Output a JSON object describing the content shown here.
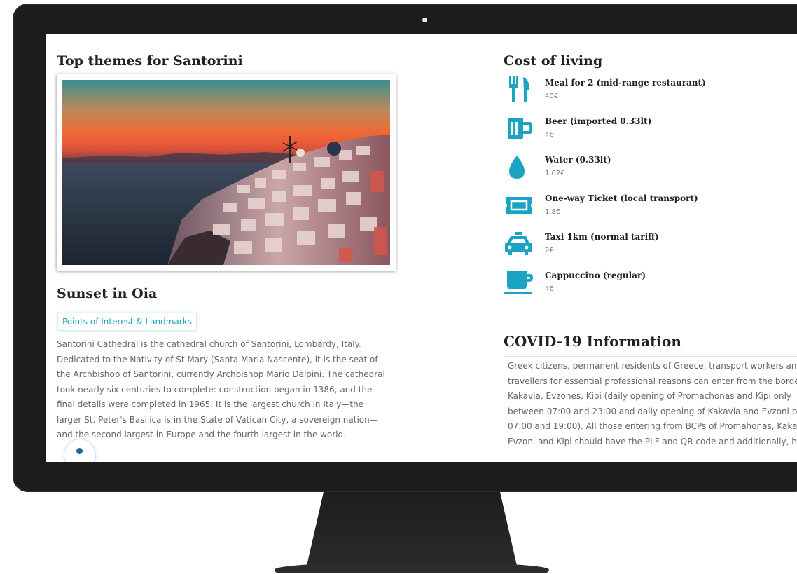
{
  "left": {
    "top_title": "Top themes for Santorini",
    "place_title": "Sunset in Oia",
    "tag": "Points of Interest & Landmarks",
    "description": "Santorini Cathedral is the cathedral church of Santorini, Lombardy, Italy. Dedicated to the Nativity of St Mary (Santa Maria Nascente), it is the seat of the Archbishop of Santorini, currently Archbishop Mario Delpini. The cathedral took nearly six centuries to complete: construction began in 1386, and the final details were completed in 1965. It is the largest church in Italy—the larger St. Peter's Basilica is in the State of Vatican City, a sovereign nation—and the second largest in Europe and the fourth largest in the world."
  },
  "cost": {
    "title": "Cost of living",
    "icon_color": "#1aa3c2",
    "items": [
      {
        "label": "Meal for 2 (mid-range restaurant)",
        "price": "40€",
        "icon": "fork-knife-icon"
      },
      {
        "label": "Beer (imported 0.33lt)",
        "price": "4€",
        "icon": "beer-mug-icon"
      },
      {
        "label": "Water (0.33lt)",
        "price": "1.62€",
        "icon": "water-drop-icon"
      },
      {
        "label": "One-way Ticket (local transport)",
        "price": "1.8€",
        "icon": "ticket-icon"
      },
      {
        "label": "Taxi 1km (normal tariff)",
        "price": "2€",
        "icon": "taxi-icon"
      },
      {
        "label": "Cappuccino (regular)",
        "price": "4€",
        "icon": "coffee-cup-icon"
      }
    ]
  },
  "covid": {
    "title": "COVID-19 Information",
    "text": "Greek citizens, permanent residents of Greece, transport workers and\ntravellers for essential professional reasons can enter from the borders of\nKakavia, Evzones, Kipi (daily opening of Promachonas and Kipi only\nbetween 07:00 and 23:00 and daily opening of Kakavia and Evzoni between\n07:00 and 19:00). All those entering from BCPs of Promahonas, Kakavia,\nEvzoni and Kipi should have the PLF and QR code and additionally, hold a"
  }
}
